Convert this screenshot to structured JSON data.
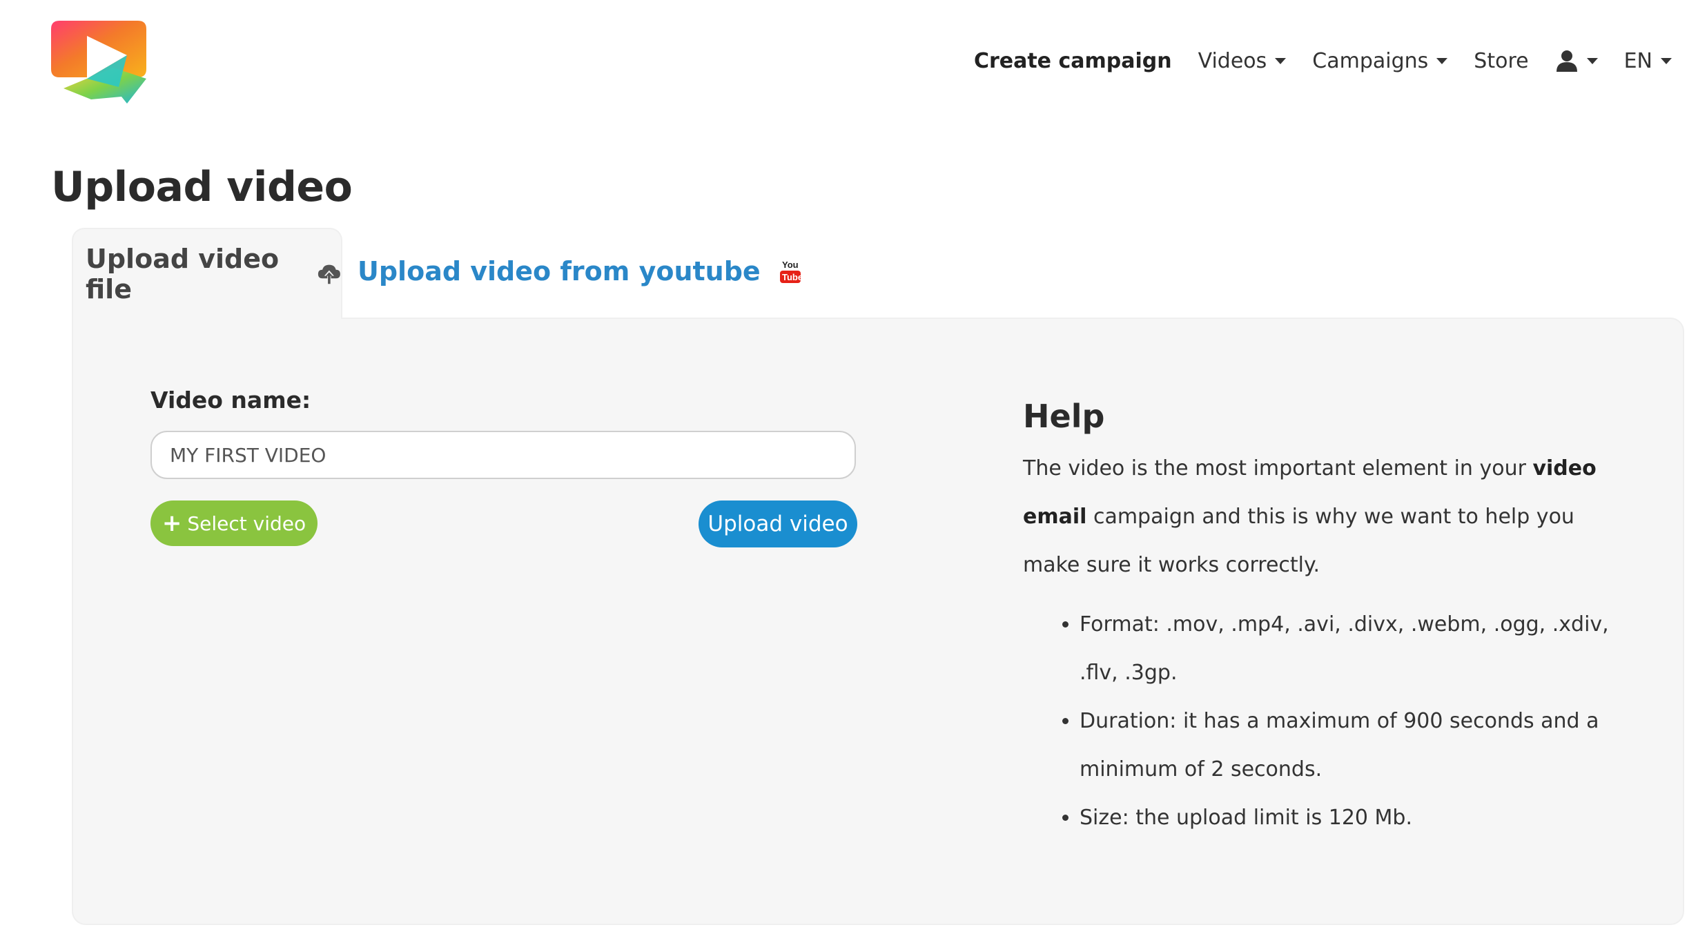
{
  "header": {
    "nav": {
      "create_campaign": "Create campaign",
      "videos": "Videos",
      "campaigns": "Campaigns",
      "store": "Store",
      "language": "EN"
    },
    "icons": {
      "logo": "play-chat-logo",
      "user": "user-icon"
    }
  },
  "page": {
    "title": "Upload video"
  },
  "tabs": {
    "file": {
      "label": "Upload video file",
      "icon": "cloud-upload-icon"
    },
    "youtube": {
      "label": "Upload video from youtube",
      "icon": "youtube-icon"
    }
  },
  "form": {
    "video_name_label": "Video name:",
    "video_name_value": "MY FIRST VIDEO",
    "select_button": "Select video",
    "upload_button": "Upload video"
  },
  "help": {
    "title": "Help",
    "intro_before": "The video is the most important element in your ",
    "intro_bold": "video email",
    "intro_after": " campaign and this is why we want to help you make sure it works correctly.",
    "items": [
      "Format: .mov, .mp4, .avi, .divx, .webm, .ogg, .xdiv, .flv, .3gp.",
      "Duration: it has a maximum of 900 seconds and a minimum of 2 seconds.",
      "Size: the upload limit is 120 Mb."
    ]
  },
  "colors": {
    "link_blue": "#2a87c8",
    "upload_button": "#1a8ed0",
    "select_button": "#8ac43f",
    "panel_bg": "#f6f6f6"
  }
}
